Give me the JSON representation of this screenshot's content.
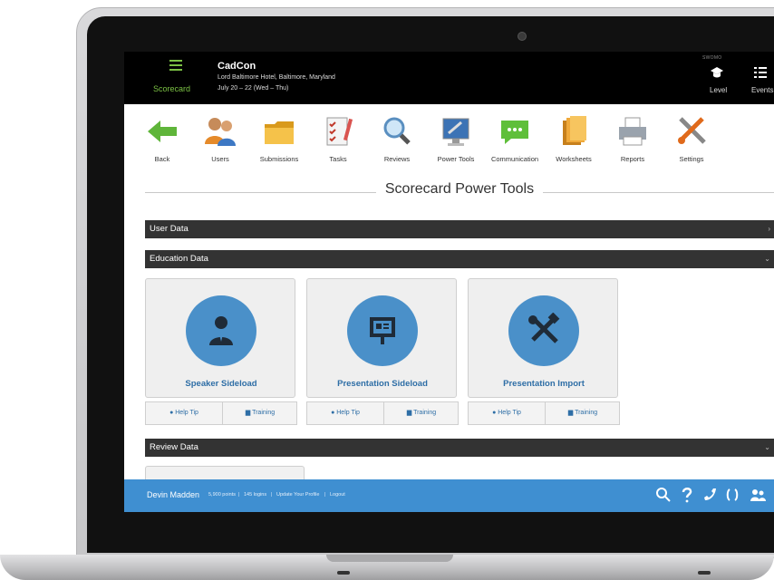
{
  "app": {
    "label": "Scorecard",
    "event_title": "CadCon",
    "event_venue": "Lord Baltimore Hotel, Baltimore, Maryland",
    "event_dates": "July 20 – 22 (Wed – Thu)",
    "top_tiny_label": "SWOMO",
    "level_label": "Level",
    "events_label": "Events"
  },
  "toolbar": {
    "items": [
      {
        "label": "Back",
        "icon": "back-arrow-icon"
      },
      {
        "label": "Users",
        "icon": "users-icon"
      },
      {
        "label": "Submissions",
        "icon": "folder-icon"
      },
      {
        "label": "Tasks",
        "icon": "tasks-icon"
      },
      {
        "label": "Reviews",
        "icon": "magnifier-icon"
      },
      {
        "label": "Power Tools",
        "icon": "power-tools-icon"
      },
      {
        "label": "Communication",
        "icon": "chat-icon"
      },
      {
        "label": "Worksheets",
        "icon": "worksheets-icon"
      },
      {
        "label": "Reports",
        "icon": "printer-icon"
      },
      {
        "label": "Settings",
        "icon": "settings-icon"
      }
    ]
  },
  "main": {
    "page_title": "Scorecard Power Tools",
    "sections": {
      "user_data": "User Data",
      "education_data": "Education Data",
      "review_data": "Review Data"
    },
    "cards": [
      {
        "title": "Speaker Sideload",
        "icon": "speaker-icon",
        "help": "Help Tip",
        "training": "Training"
      },
      {
        "title": "Presentation Sideload",
        "icon": "presentation-icon",
        "help": "Help Tip",
        "training": "Training"
      },
      {
        "title": "Presentation Import",
        "icon": "tools-icon",
        "help": "Help Tip",
        "training": "Training"
      }
    ]
  },
  "footer": {
    "user": "Devin Madden",
    "points": "5,900 points",
    "logins": "145 logins",
    "update_profile": "Update Your Profile",
    "logout": "Logout"
  },
  "colors": {
    "accent_blue": "#3f8fd1",
    "card_icon_blue": "#4a90c9",
    "topbar_green": "#7bc144",
    "section_bar": "#333333"
  }
}
